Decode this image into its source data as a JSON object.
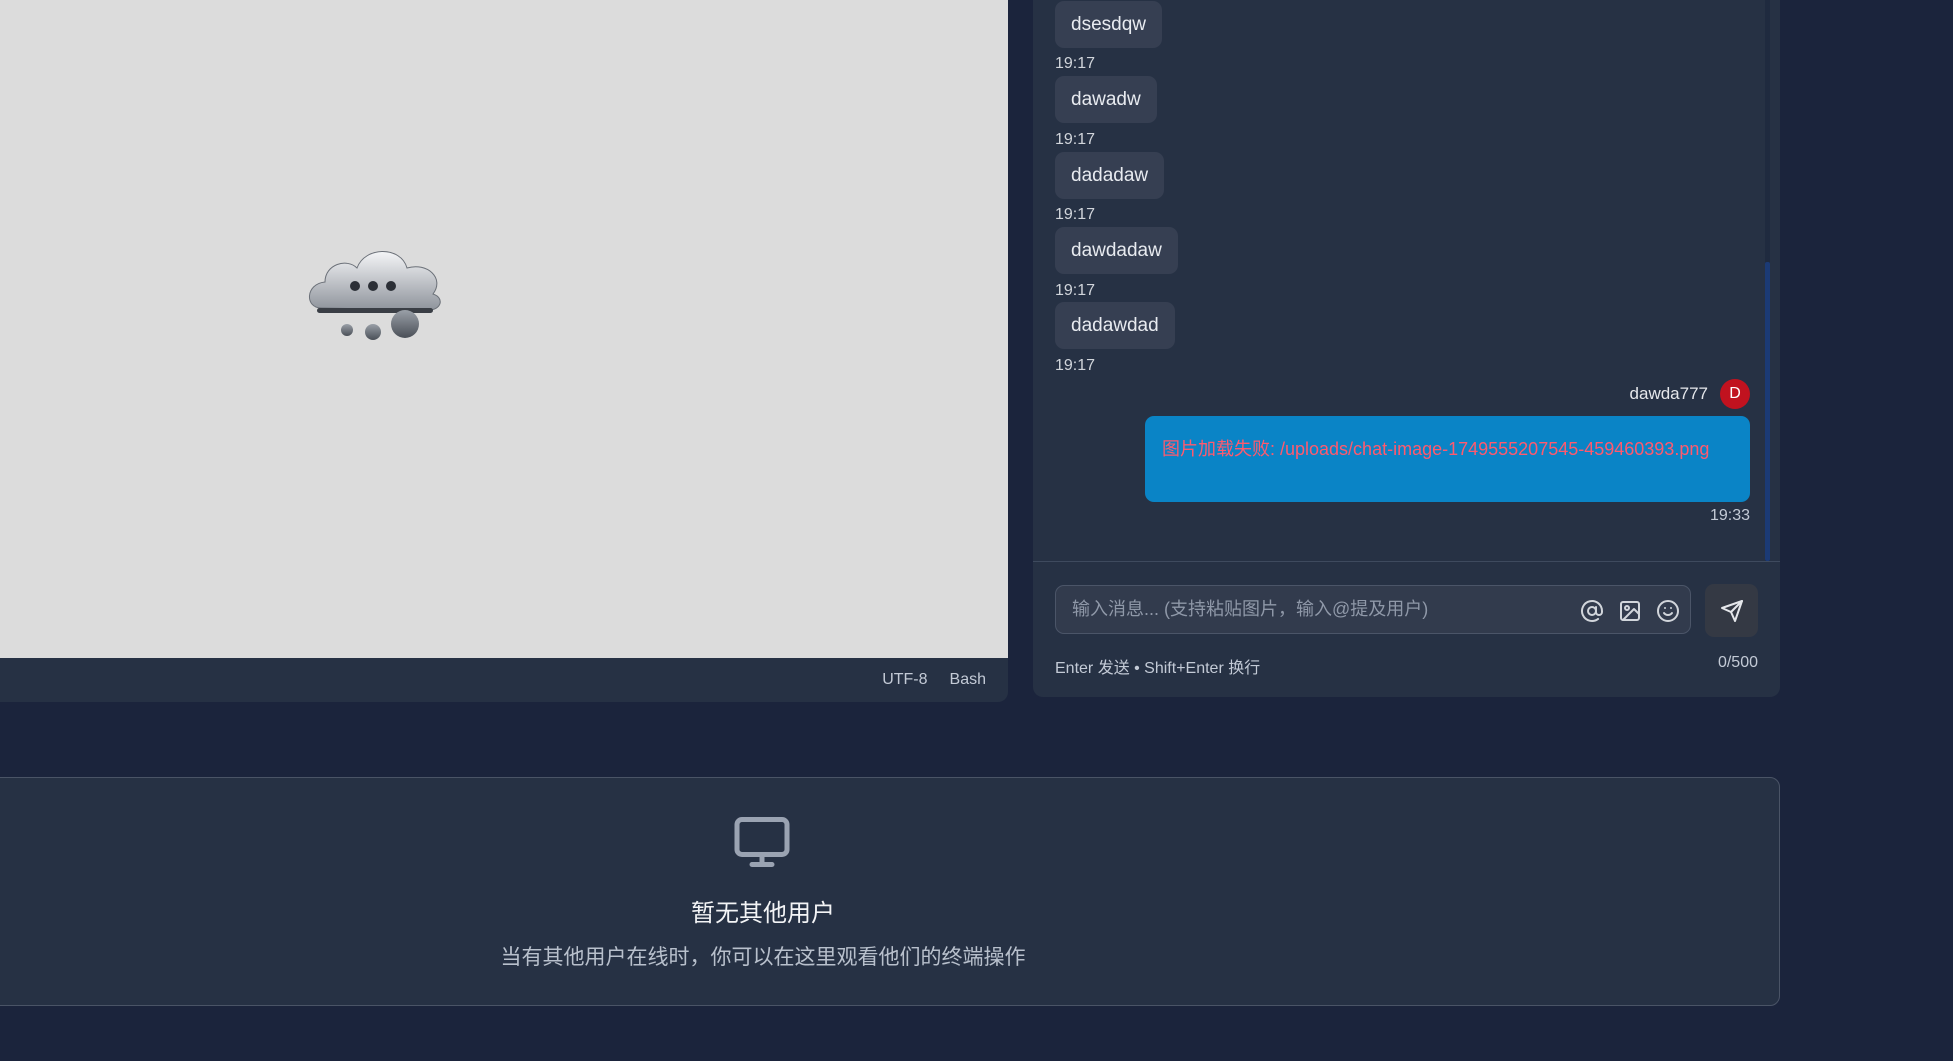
{
  "terminal": {
    "encoding": "UTF-8",
    "shell": "Bash",
    "loading_icon": "cloud-thinking-icon"
  },
  "chat": {
    "messages": [
      {
        "text": "dsesdqw",
        "time": "19:17"
      },
      {
        "text": "dawadw",
        "time": "19:17"
      },
      {
        "text": "dadadaw",
        "time": "19:17"
      },
      {
        "text": "dawdadaw",
        "time": "19:17"
      },
      {
        "text": "dadawdad",
        "time": "19:17"
      }
    ],
    "own_message": {
      "username": "dawda777",
      "avatar_letter": "D",
      "text": "图片加载失败: /uploads/chat-image-1749555207545-459460393.png",
      "time": "19:33"
    },
    "input": {
      "placeholder": "输入消息... (支持粘贴图片，输入@提及用户)",
      "value": "",
      "hint": "Enter 发送 • Shift+Enter 换行",
      "counter": "0/500"
    },
    "icons": {
      "mention": "at-icon",
      "image": "image-icon",
      "emoji": "smile-icon",
      "send": "send-icon"
    }
  },
  "users_panel": {
    "icon": "monitor-icon",
    "title": "暂无其他用户",
    "description": "当有其他用户在线时，你可以在这里观看他们的终端操作"
  },
  "colors": {
    "background": "#1b243c",
    "panel": "#263144",
    "own_bubble": "#0a84c6",
    "error_text": "#ff5a6e",
    "avatar": "#c1121f"
  }
}
